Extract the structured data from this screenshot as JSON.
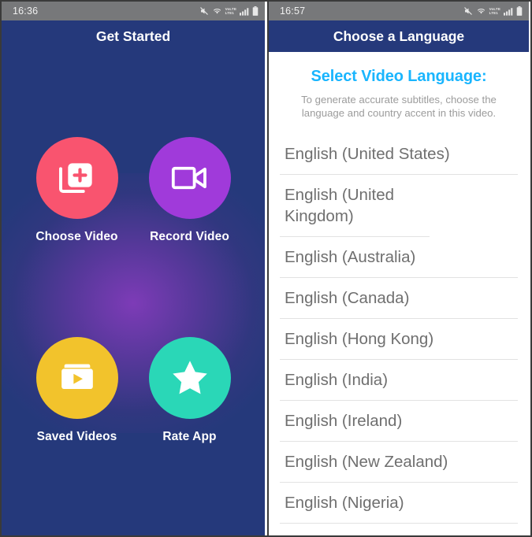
{
  "colors": {
    "navy": "#25397b",
    "statusbar_gray": "#77787a",
    "accent_blue": "#19b5fe",
    "tile_pink": "#f9546f",
    "tile_purple": "#a03ada",
    "tile_yellow": "#f2c32c",
    "tile_teal": "#2ad7b7",
    "list_text": "#6f6f6f",
    "subtitle_gray": "#9c9c9c"
  },
  "left_phone": {
    "statusbar": {
      "time": "16:36",
      "icons": [
        "mute-icon",
        "wifi-icon",
        "volte-lte-icon",
        "signal-bars-icon",
        "battery-icon"
      ],
      "volte_top": "VoLTE",
      "volte_bottom": "LTE1"
    },
    "appbar": {
      "title": "Get Started"
    },
    "tiles": [
      {
        "label": "Choose Video",
        "icon": "add-to-library-icon",
        "color": "#f9546f"
      },
      {
        "label": "Record Video",
        "icon": "video-camera-icon",
        "color": "#a03ada"
      },
      {
        "label": "Saved Videos",
        "icon": "folder-play-icon",
        "color": "#f2c32c"
      },
      {
        "label": "Rate App",
        "icon": "star-icon",
        "color": "#2ad7b7"
      }
    ]
  },
  "right_phone": {
    "statusbar": {
      "time": "16:57",
      "icons": [
        "mute-icon",
        "wifi-icon",
        "volte-lte-icon",
        "signal-bars-icon",
        "battery-icon"
      ],
      "volte_top": "VoLTE",
      "volte_bottom": "LTE1"
    },
    "appbar": {
      "title": "Choose a Language"
    },
    "heading": "Select Video Language:",
    "subtitle": "To generate accurate subtitles, choose the language and country accent in this video.",
    "languages": [
      "English (United States)",
      "English (United Kingdom)",
      "English (Australia)",
      "English (Canada)",
      "English (Hong Kong)",
      "English (India)",
      "English (Ireland)",
      "English (New Zealand)",
      "English (Nigeria)"
    ]
  }
}
